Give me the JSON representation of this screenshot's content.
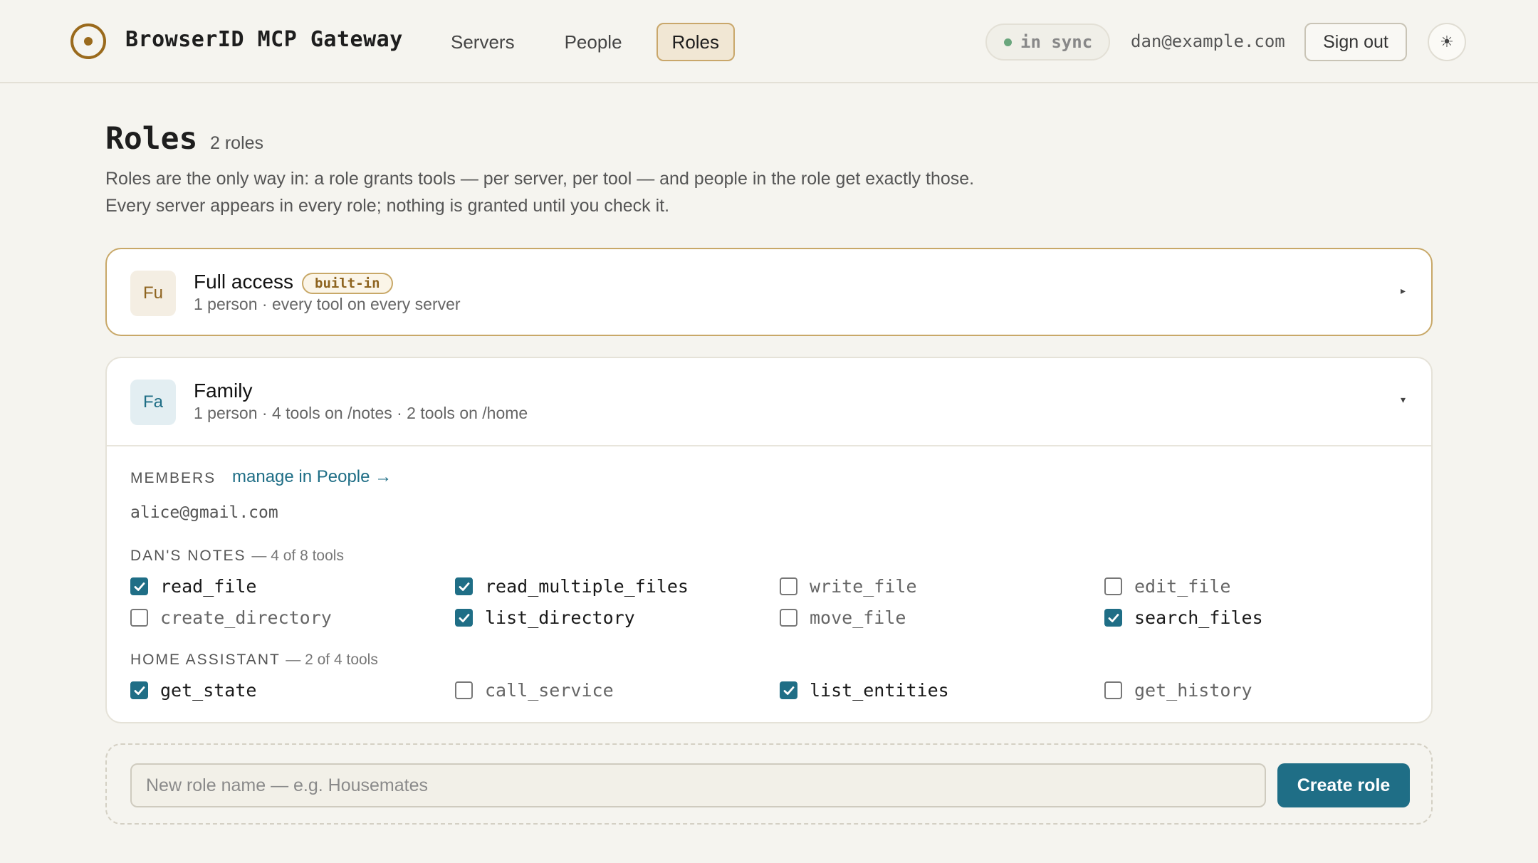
{
  "app": {
    "title": "BrowserID MCP Gateway"
  },
  "nav": {
    "items": [
      {
        "label": "Servers",
        "active": false
      },
      {
        "label": "People",
        "active": false
      },
      {
        "label": "Roles",
        "active": true
      }
    ]
  },
  "status": {
    "sync_label": "in sync",
    "sync_color": "#6aa67d"
  },
  "user": {
    "email": "dan@example.com",
    "signout_label": "Sign out",
    "theme_icon": "sun-icon"
  },
  "page": {
    "title": "Roles",
    "count": "2 roles",
    "intro": "Roles are the only way in: a role grants tools — per server, per tool — and people in the role get exactly those. Every server appears in every role; nothing is granted until you check it."
  },
  "roles": [
    {
      "initials": "Fu",
      "name": "Full access",
      "badge": "built-in",
      "summary": "1 person · every tool on every server",
      "expanded": false,
      "chevron": "▸"
    },
    {
      "initials": "Fa",
      "name": "Family",
      "summary": "1 person · 4 tools on /notes · 2 tools on /home",
      "expanded": true,
      "chevron": "▾",
      "members_label": "MEMBERS",
      "manage_link": "manage in People →",
      "members": [
        "alice@gmail.com"
      ],
      "servers": [
        {
          "name": "DAN'S NOTES",
          "summary": "— 4 of 8 tools",
          "tools": [
            {
              "name": "read_file",
              "checked": true
            },
            {
              "name": "read_multiple_files",
              "checked": true
            },
            {
              "name": "write_file",
              "checked": false
            },
            {
              "name": "edit_file",
              "checked": false
            },
            {
              "name": "create_directory",
              "checked": false
            },
            {
              "name": "list_directory",
              "checked": true
            },
            {
              "name": "move_file",
              "checked": false
            },
            {
              "name": "search_files",
              "checked": true
            }
          ]
        },
        {
          "name": "HOME ASSISTANT",
          "summary": "— 2 of 4 tools",
          "tools": [
            {
              "name": "get_state",
              "checked": true
            },
            {
              "name": "call_service",
              "checked": false
            },
            {
              "name": "list_entities",
              "checked": true
            },
            {
              "name": "get_history",
              "checked": false
            }
          ]
        }
      ]
    }
  ],
  "new_role": {
    "placeholder": "New role name — e.g. Housemates",
    "button_label": "Create role"
  },
  "colors": {
    "accent": "#1f6e86",
    "brand": "#9a6a1c",
    "background": "#f5f4ef"
  }
}
